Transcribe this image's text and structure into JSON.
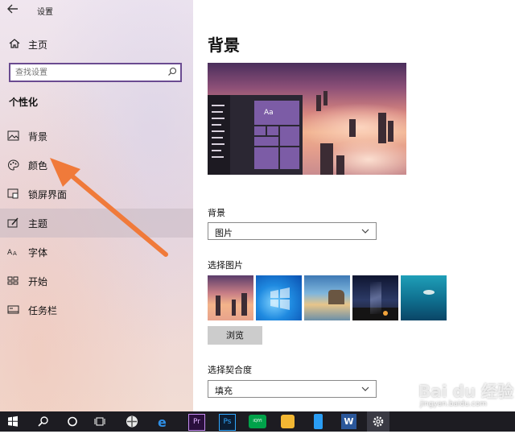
{
  "window": {
    "title": "设置"
  },
  "sidebar": {
    "home_label": "主页",
    "search_placeholder": "查找设置",
    "section_title": "个性化",
    "items": [
      {
        "label": "背景",
        "icon": "image-icon"
      },
      {
        "label": "颜色",
        "icon": "palette-icon"
      },
      {
        "label": "锁屏界面",
        "icon": "lock-screen-icon"
      },
      {
        "label": "主题",
        "icon": "theme-brush-icon",
        "active": true
      },
      {
        "label": "字体",
        "icon": "font-icon"
      },
      {
        "label": "开始",
        "icon": "start-icon"
      },
      {
        "label": "任务栏",
        "icon": "taskbar-icon"
      }
    ]
  },
  "main": {
    "page_title": "背景",
    "preview_tile_label": "Aa",
    "background_label": "背景",
    "background_value": "图片",
    "choose_picture_label": "选择图片",
    "browse_label": "浏览",
    "fit_label": "选择契合度",
    "fit_value": "填充"
  },
  "taskbar": {
    "icons": [
      "windows-start-icon",
      "search-icon",
      "cortana-icon",
      "task-view-icon",
      "pinwheel-app-icon",
      "edge-icon",
      "premiere-icon",
      "photoshop-icon",
      "iqiyi-icon",
      "image-viewer-icon",
      "phone-app-icon",
      "word-icon",
      "settings-icon"
    ],
    "premiere_text": "Pr",
    "photoshop_text": "Ps",
    "iqiyi_text": "iQIYI",
    "word_text": "W"
  },
  "watermark": {
    "main": "Bai du 经验",
    "sub": "jingyan.baidu.com"
  },
  "colors": {
    "accent": "#6a4b91",
    "tile": "#7c5ca6",
    "arrow": "#f07a3a",
    "taskbar": "#1d1c22"
  }
}
